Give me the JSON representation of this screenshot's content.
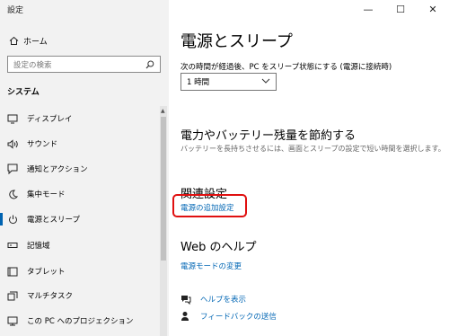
{
  "app": {
    "title": "設定"
  },
  "window": {
    "minimize": "—",
    "maximize": "☐",
    "close": "✕"
  },
  "sidebar": {
    "home_label": "ホーム",
    "search_placeholder": "設定の検索",
    "section_title": "システム",
    "items": [
      {
        "label": "ディスプレイ",
        "icon": "display-icon"
      },
      {
        "label": "サウンド",
        "icon": "sound-icon"
      },
      {
        "label": "通知とアクション",
        "icon": "notification-icon"
      },
      {
        "label": "集中モード",
        "icon": "focus-moon-icon"
      },
      {
        "label": "電源とスリープ",
        "icon": "power-icon",
        "active": true
      },
      {
        "label": "記憶域",
        "icon": "storage-icon"
      },
      {
        "label": "タブレット",
        "icon": "tablet-icon"
      },
      {
        "label": "マルチタスク",
        "icon": "multitask-icon"
      },
      {
        "label": "この PC へのプロジェクション",
        "icon": "projection-icon"
      }
    ]
  },
  "main": {
    "title": "電源とスリープ",
    "sleep_label": "次の時間が経過後、PC をスリープ状態にする (電源に接続時)",
    "sleep_value": "1 時間",
    "save_heading": "電力やバッテリー残量を節約する",
    "save_desc": "バッテリーを長持ちさせるには、画面とスリープの設定で短い時間を選択します。",
    "related_heading": "関連設定",
    "related_link": "電源の追加設定",
    "web_help_heading": "Web のヘルプ",
    "web_help_link": "電源モードの変更",
    "help_link": "ヘルプを表示",
    "feedback_link": "フィードバックの送信"
  },
  "colors": {
    "accent": "#0063b1",
    "link": "#0066b4",
    "highlight": "#e01010"
  }
}
